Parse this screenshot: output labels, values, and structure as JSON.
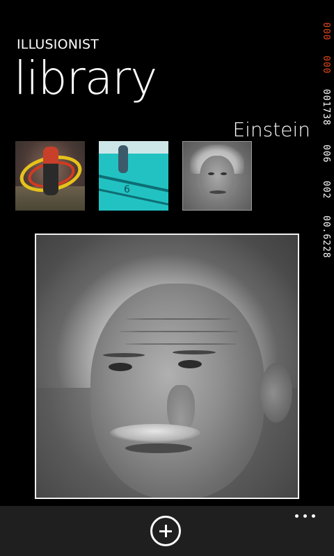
{
  "app": {
    "title": "ILLUSIONIST",
    "page_title": "library",
    "selected_item_name": "Einstein"
  },
  "status_bar": {
    "segments": [
      {
        "text": "000",
        "color": "#e0491c"
      },
      {
        "text": "000",
        "color": "#e0491c"
      },
      {
        "text": "001738",
        "color": "#ffffff"
      },
      {
        "text": "006",
        "color": "#ffffff"
      },
      {
        "text": "002",
        "color": "#ffffff"
      },
      {
        "text": "00.6228",
        "color": "#ffffff"
      }
    ]
  },
  "library": {
    "items": [
      {
        "icon": "soccer-illusion-thumbnail"
      },
      {
        "icon": "pool-illusion-thumbnail"
      },
      {
        "icon": "einstein-thumbnail",
        "selected": true
      }
    ],
    "preview_icon": "einstein-hybrid-image"
  },
  "app_bar": {
    "add_icon": "add-circle-icon",
    "more_icon": "ellipsis-icon"
  }
}
